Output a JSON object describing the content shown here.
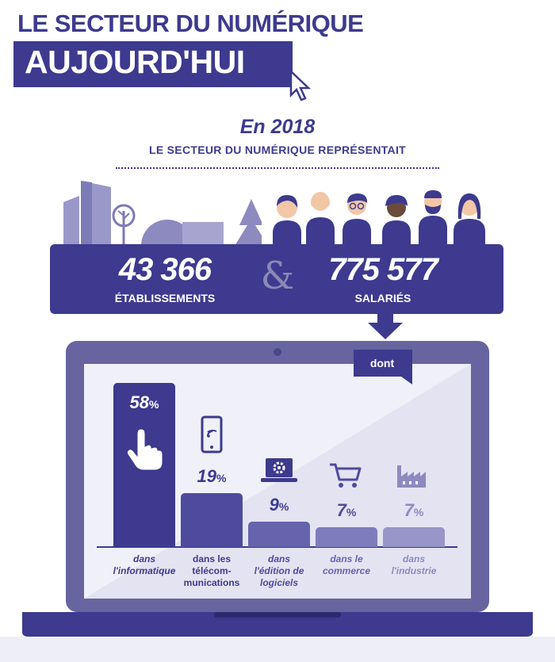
{
  "header": {
    "title_line1": "LE SECTEUR DU NUMÉRIQUE",
    "title_line2": "AUJOURD'HUI"
  },
  "intro": {
    "year": "En 2018",
    "subtitle": "LE SECTEUR DU NUMÉRIQUE REPRÉSENTAIT"
  },
  "stats": {
    "establishments_value": "43 366",
    "establishments_label": "ÉTABLISSEMENTS",
    "connector": "&",
    "employees_value": "775 577",
    "employees_label": "SALARIÉS"
  },
  "screen": {
    "tag": "dont"
  },
  "chart_data": {
    "type": "bar",
    "unit": "%",
    "categories": [
      "dans l'informatique",
      "dans les télécom-munications",
      "dans l'édition de logiciels",
      "dans le commerce",
      "dans l'industrie"
    ],
    "category_lines": [
      [
        "dans",
        "l'informatique"
      ],
      [
        "dans les",
        "télécom-",
        "munications"
      ],
      [
        "dans",
        "l'édition de",
        "logiciels"
      ],
      [
        "dans le",
        "commerce"
      ],
      [
        "dans",
        "l'industrie"
      ]
    ],
    "values": [
      58,
      19,
      9,
      7,
      7
    ],
    "labels": [
      "58",
      "19",
      "9",
      "7",
      "7"
    ],
    "icons": [
      "pointer-hand-icon",
      "smartphone-icon",
      "laptop-gear-icon",
      "shopping-cart-icon",
      "factory-icon"
    ],
    "colors": [
      "#3d3a8f",
      "#4e4b9e",
      "#6764ad",
      "#7f7cbb",
      "#9895c8"
    ]
  },
  "colors": {
    "brand": "#3d3a8f",
    "screen_bg": "#f0f0f8",
    "laptop": "#67649f"
  }
}
